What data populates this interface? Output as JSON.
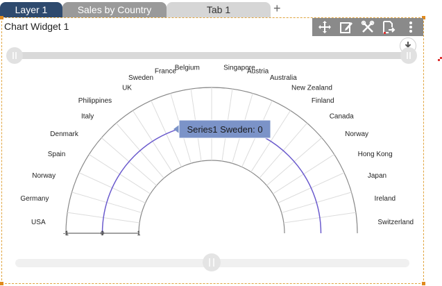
{
  "tabs": [
    {
      "label": "Layer 1"
    },
    {
      "label": "Sales by Country"
    },
    {
      "label": "Tab 1"
    }
  ],
  "add_tab_icon": "plus-icon",
  "widget": {
    "title": "Chart Widget 1",
    "toolbar_icons": [
      "move-icon",
      "edit-icon",
      "tools-icon",
      "export-icon",
      "more-vertical-icon"
    ],
    "download_icon": "download-icon"
  },
  "tooltip": {
    "text": "Series1 Sweden: 0"
  },
  "colors": {
    "tab_active": "#2e4a6e",
    "series": "#6a5acd",
    "toolbar": "#8a8a8a",
    "tooltip_bg": "#7b93c8"
  },
  "chart_data": {
    "type": "radial-bar",
    "categories": [
      "USA",
      "Germany",
      "Norway",
      "Spain",
      "Denmark",
      "Italy",
      "Philippines",
      "UK",
      "Sweden",
      "France",
      "Belgium",
      "Singapore",
      "Austria",
      "Australia",
      "New Zealand",
      "Finland",
      "Canada",
      "Norway",
      "Hong Kong",
      "Japan",
      "Ireland",
      "Switzerland"
    ],
    "series": [
      {
        "name": "Series1",
        "values": [
          0,
          0,
          0,
          0,
          0,
          0,
          0,
          0,
          0,
          0,
          0,
          0,
          0,
          0,
          0,
          0,
          0,
          0,
          0,
          0,
          0,
          0
        ]
      }
    ],
    "axis_ticks": [
      "-1",
      "0",
      "1"
    ],
    "ylim": [
      -1,
      1
    ]
  }
}
